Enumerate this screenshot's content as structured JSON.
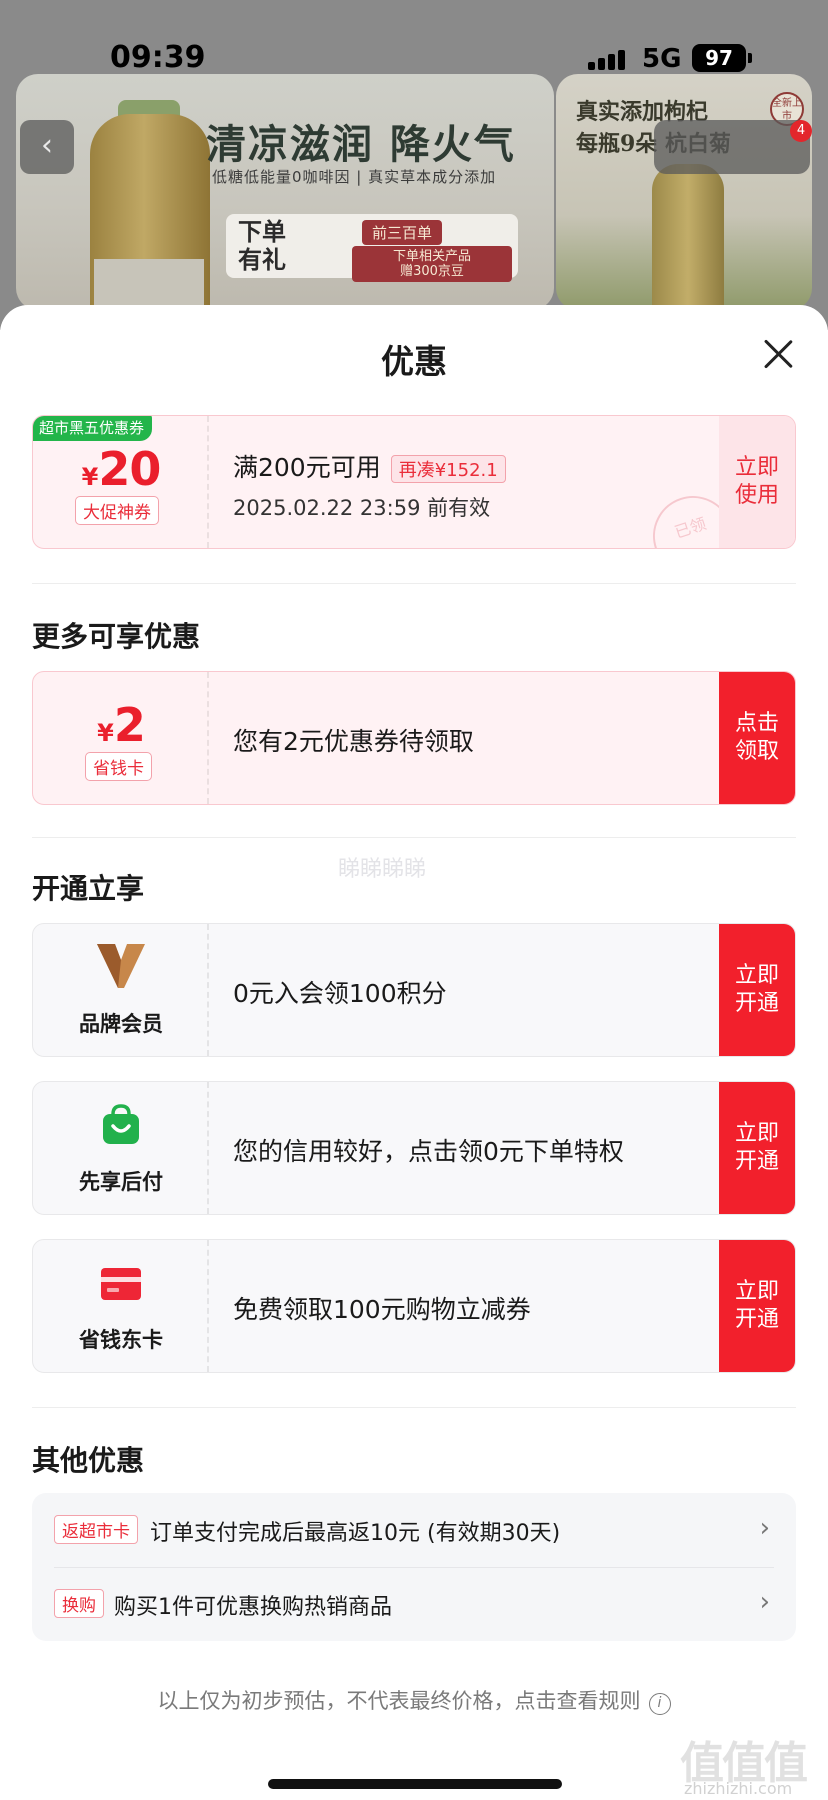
{
  "status_bar": {
    "time": "09:39",
    "network": "5G",
    "battery": "97"
  },
  "background": {
    "banner_title": "清凉滋润 降火气",
    "banner_subtitle": "低糖低能量0咖啡因 | 真实草本成分添加",
    "promo_left_line1": "下单",
    "promo_left_line2": "有礼",
    "promo_tag": "前三百单",
    "promo_text_line1": "下单相关产品",
    "promo_text_line2": "赠300京豆",
    "side_line1": "真实添加枸杞",
    "side_line2": "每瓶9朵 杭白菊",
    "side_badge": "全新上市",
    "badge_count": "4",
    "back_icon": "chevron-left-icon"
  },
  "sheet": {
    "title": "优惠",
    "close_icon": "close-icon"
  },
  "coupon": {
    "tag": "超市黑五优惠券",
    "currency": "¥",
    "amount": "20",
    "label": "大促神券",
    "condition": "满200元可用",
    "top_up": "再凑¥152.1",
    "expiry": "2025.02.22 23:59 前有效",
    "action": "立即使用",
    "stamp": "已领"
  },
  "more": {
    "title": "更多可享优惠",
    "currency": "¥",
    "amount": "2",
    "label": "省钱卡",
    "text": "您有2元优惠券待领取",
    "action": "点击领取"
  },
  "open": {
    "title": "开通立享",
    "faint_mark": "睇睇睇睇",
    "items": [
      {
        "label": "品牌会员",
        "text": "0元入会领100积分",
        "action": "立即开通",
        "icon": "brand-v-icon"
      },
      {
        "label": "先享后付",
        "text": "您的信用较好，点击领0元下单特权",
        "action": "立即开通",
        "icon": "shopping-bag-icon"
      },
      {
        "label": "省钱东卡",
        "text": "免费领取100元购物立减券",
        "action": "立即开通",
        "icon": "card-icon"
      }
    ]
  },
  "other": {
    "title": "其他优惠",
    "rows": [
      {
        "tag": "返超市卡",
        "text": "订单支付完成后最高返10元 (有效期30天)"
      },
      {
        "tag": "换购",
        "text": "购买1件可优惠换购热销商品"
      }
    ]
  },
  "footnote": "以上仅为初步预估，不代表最终价格，点击查看规则",
  "watermark": {
    "main": "值值值",
    "sub": "zhizhizhi.com"
  },
  "colors": {
    "accent_red": "#f2202c",
    "coupon_pink": "#fff2f4",
    "tag_green": "#23b54a",
    "vip_gold": "#c7874a"
  }
}
